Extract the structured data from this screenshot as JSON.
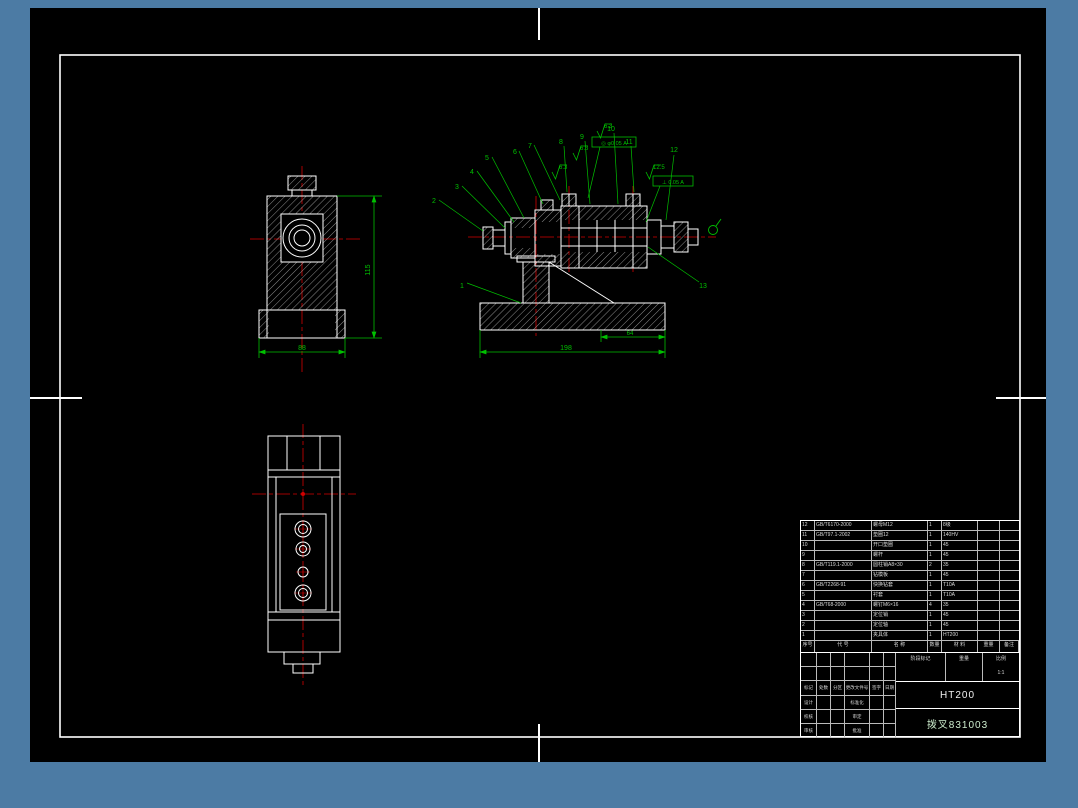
{
  "canvas": {
    "bg": "#4c7ba4",
    "paper": "#000000",
    "line": "#ffffff",
    "accent_green": "#00c000",
    "accent_red": "#d40000"
  },
  "drawing": {
    "callouts": [
      "1",
      "2",
      "3",
      "4",
      "5",
      "6",
      "7",
      "8",
      "9",
      "10",
      "11",
      "12",
      "13"
    ],
    "dims": {
      "front_height": "115",
      "front_width": "88",
      "base_width": "198",
      "base_step": "64"
    },
    "roughness": [
      "6.3",
      "6.3",
      "6.3",
      "12.5"
    ],
    "gdt": [
      "◎ φ0.05 A",
      "⊥ 0.05 A"
    ]
  },
  "bom": {
    "headers": [
      "序号",
      "代  号",
      "名  称",
      "数量",
      "材  料",
      "重量",
      "备注"
    ],
    "rows": [
      {
        "no": "12",
        "code": "GB/T6170-2000",
        "name": "螺母M12",
        "qty": "1",
        "material": "8级",
        "weight": "",
        "note": ""
      },
      {
        "no": "11",
        "code": "GB/T97.1-2002",
        "name": "垫圈12",
        "qty": "1",
        "material": "140HV",
        "weight": "",
        "note": ""
      },
      {
        "no": "10",
        "code": "",
        "name": "开口垫圈",
        "qty": "1",
        "material": "45",
        "weight": "",
        "note": ""
      },
      {
        "no": "9",
        "code": "",
        "name": "螺杆",
        "qty": "1",
        "material": "45",
        "weight": "",
        "note": ""
      },
      {
        "no": "8",
        "code": "GB/T119.1-2000",
        "name": "圆柱销A8×30",
        "qty": "2",
        "material": "35",
        "weight": "",
        "note": ""
      },
      {
        "no": "7",
        "code": "",
        "name": "钻模板",
        "qty": "1",
        "material": "45",
        "weight": "",
        "note": ""
      },
      {
        "no": "6",
        "code": "GB/T2268-91",
        "name": "快换钻套",
        "qty": "1",
        "material": "T10A",
        "weight": "",
        "note": ""
      },
      {
        "no": "5",
        "code": "",
        "name": "衬套",
        "qty": "1",
        "material": "T10A",
        "weight": "",
        "note": ""
      },
      {
        "no": "4",
        "code": "GB/T68-2000",
        "name": "螺钉M6×16",
        "qty": "4",
        "material": "35",
        "weight": "",
        "note": ""
      },
      {
        "no": "3",
        "code": "",
        "name": "定位销",
        "qty": "1",
        "material": "45",
        "weight": "",
        "note": ""
      },
      {
        "no": "2",
        "code": "",
        "name": "定位轴",
        "qty": "1",
        "material": "45",
        "weight": "",
        "note": ""
      },
      {
        "no": "1",
        "code": "",
        "name": "夹具体",
        "qty": "1",
        "material": "HT200",
        "weight": "",
        "note": ""
      }
    ]
  },
  "titleblock": {
    "material": "HT200",
    "part_name": "拨叉831003",
    "stage_label": "阶段标记",
    "weight_label": "重量",
    "scale_label": "比例",
    "scale_value": "1:1",
    "left_rows": [
      [
        "",
        "",
        "",
        "",
        "",
        ""
      ],
      [
        "",
        "",
        "",
        "",
        "",
        ""
      ],
      [
        "标记",
        "处数",
        "分区",
        "更改文件号",
        "签字",
        "日期"
      ],
      [
        "设计",
        "",
        "",
        "标准化",
        "",
        ""
      ],
      [
        "校核",
        "",
        "",
        "审定",
        "",
        ""
      ],
      [
        "审核",
        "",
        "",
        "批准",
        "",
        ""
      ]
    ]
  }
}
